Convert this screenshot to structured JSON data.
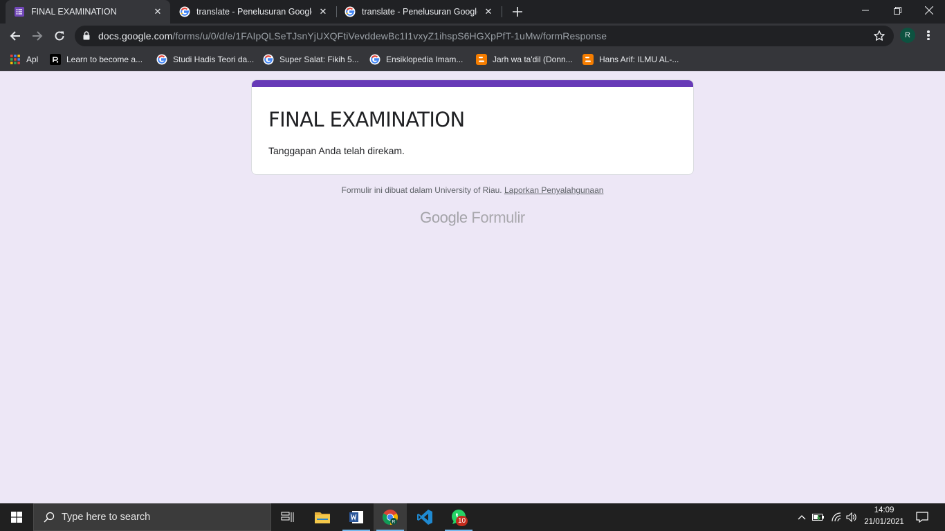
{
  "browser": {
    "tabs": [
      {
        "title": "FINAL EXAMINATION",
        "favicon": "google-forms-icon",
        "active": true
      },
      {
        "title": "translate - Penelusuran Google",
        "favicon": "google-g-icon",
        "active": false
      },
      {
        "title": "translate - Penelusuran Google",
        "favicon": "google-g-icon",
        "active": false
      }
    ],
    "url_host": "docs.google.com",
    "url_path": "/forms/u/0/d/e/1FAIpQLSeTJsnYjUXQFtiVevddewBc1I1vxyZ1ihspS6HGXpPfT-1uMw/formResponse",
    "profile_initial": "R",
    "bookmarks": [
      {
        "label": "Apl",
        "icon": "apps-grid-icon"
      },
      {
        "label": "Learn to become a...",
        "icon": "site-r-icon"
      },
      {
        "label": "Studi Hadis Teori da...",
        "icon": "google-g-icon"
      },
      {
        "label": "Super Salat: Fikih 5...",
        "icon": "google-g-icon"
      },
      {
        "label": "Ensiklopedia Imam...",
        "icon": "google-g-icon"
      },
      {
        "label": "Jarh wa ta'dil (Donn...",
        "icon": "blogger-icon"
      },
      {
        "label": "Hans Arif: ILMU AL-...",
        "icon": "blogger-icon"
      }
    ]
  },
  "form": {
    "title": "FINAL EXAMINATION",
    "message": "Tanggapan Anda telah direkam.",
    "footer_text": "Formulir ini dibuat dalam University of Riau. ",
    "footer_link": "Laporkan Penyalahgunaan",
    "brand_google": "Google",
    "brand_product": "Formulir",
    "accent_color": "#673ab7"
  },
  "taskbar": {
    "search_placeholder": "Type here to search",
    "whatsapp_badge": "10",
    "chrome_profile_initial": "R",
    "time": "14:09",
    "date": "21/01/2021"
  }
}
